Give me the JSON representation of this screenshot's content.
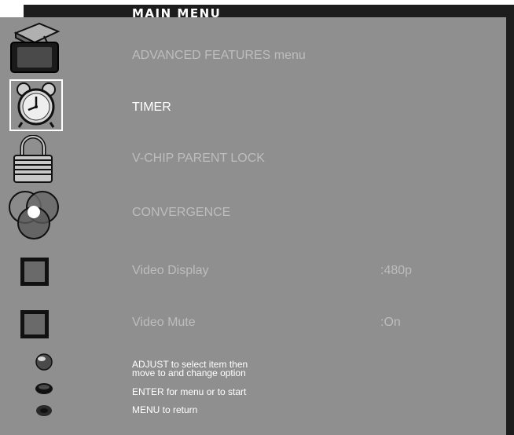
{
  "menu": {
    "title": "MAIN MENU",
    "items": [
      {
        "label": "ADVANCED FEATURES menu",
        "icon": "tv-icon",
        "value": ""
      },
      {
        "label": "TIMER",
        "icon": "alarm-clock-icon",
        "value": "",
        "selected": true
      },
      {
        "label": "V-CHIP PARENT LOCK",
        "icon": "padlock-icon",
        "value": ""
      },
      {
        "label": "CONVERGENCE",
        "icon": "color-circles-icon",
        "value": ""
      },
      {
        "label": "Video Display",
        "icon": "square-icon",
        "value": ":480p"
      },
      {
        "label": "Video Mute",
        "icon": "square-icon",
        "value": ":On"
      }
    ]
  },
  "hints": {
    "adjust_line1": "ADJUST to select item then",
    "adjust_line2": "move to and change option",
    "enter": "ENTER for menu or to start",
    "menu": "MENU to return"
  },
  "colors": {
    "panel": "#8f8f8f",
    "shadow": "#1d1d1d",
    "active_text": "#ffffff",
    "inactive_text": "#bdbdbd"
  }
}
